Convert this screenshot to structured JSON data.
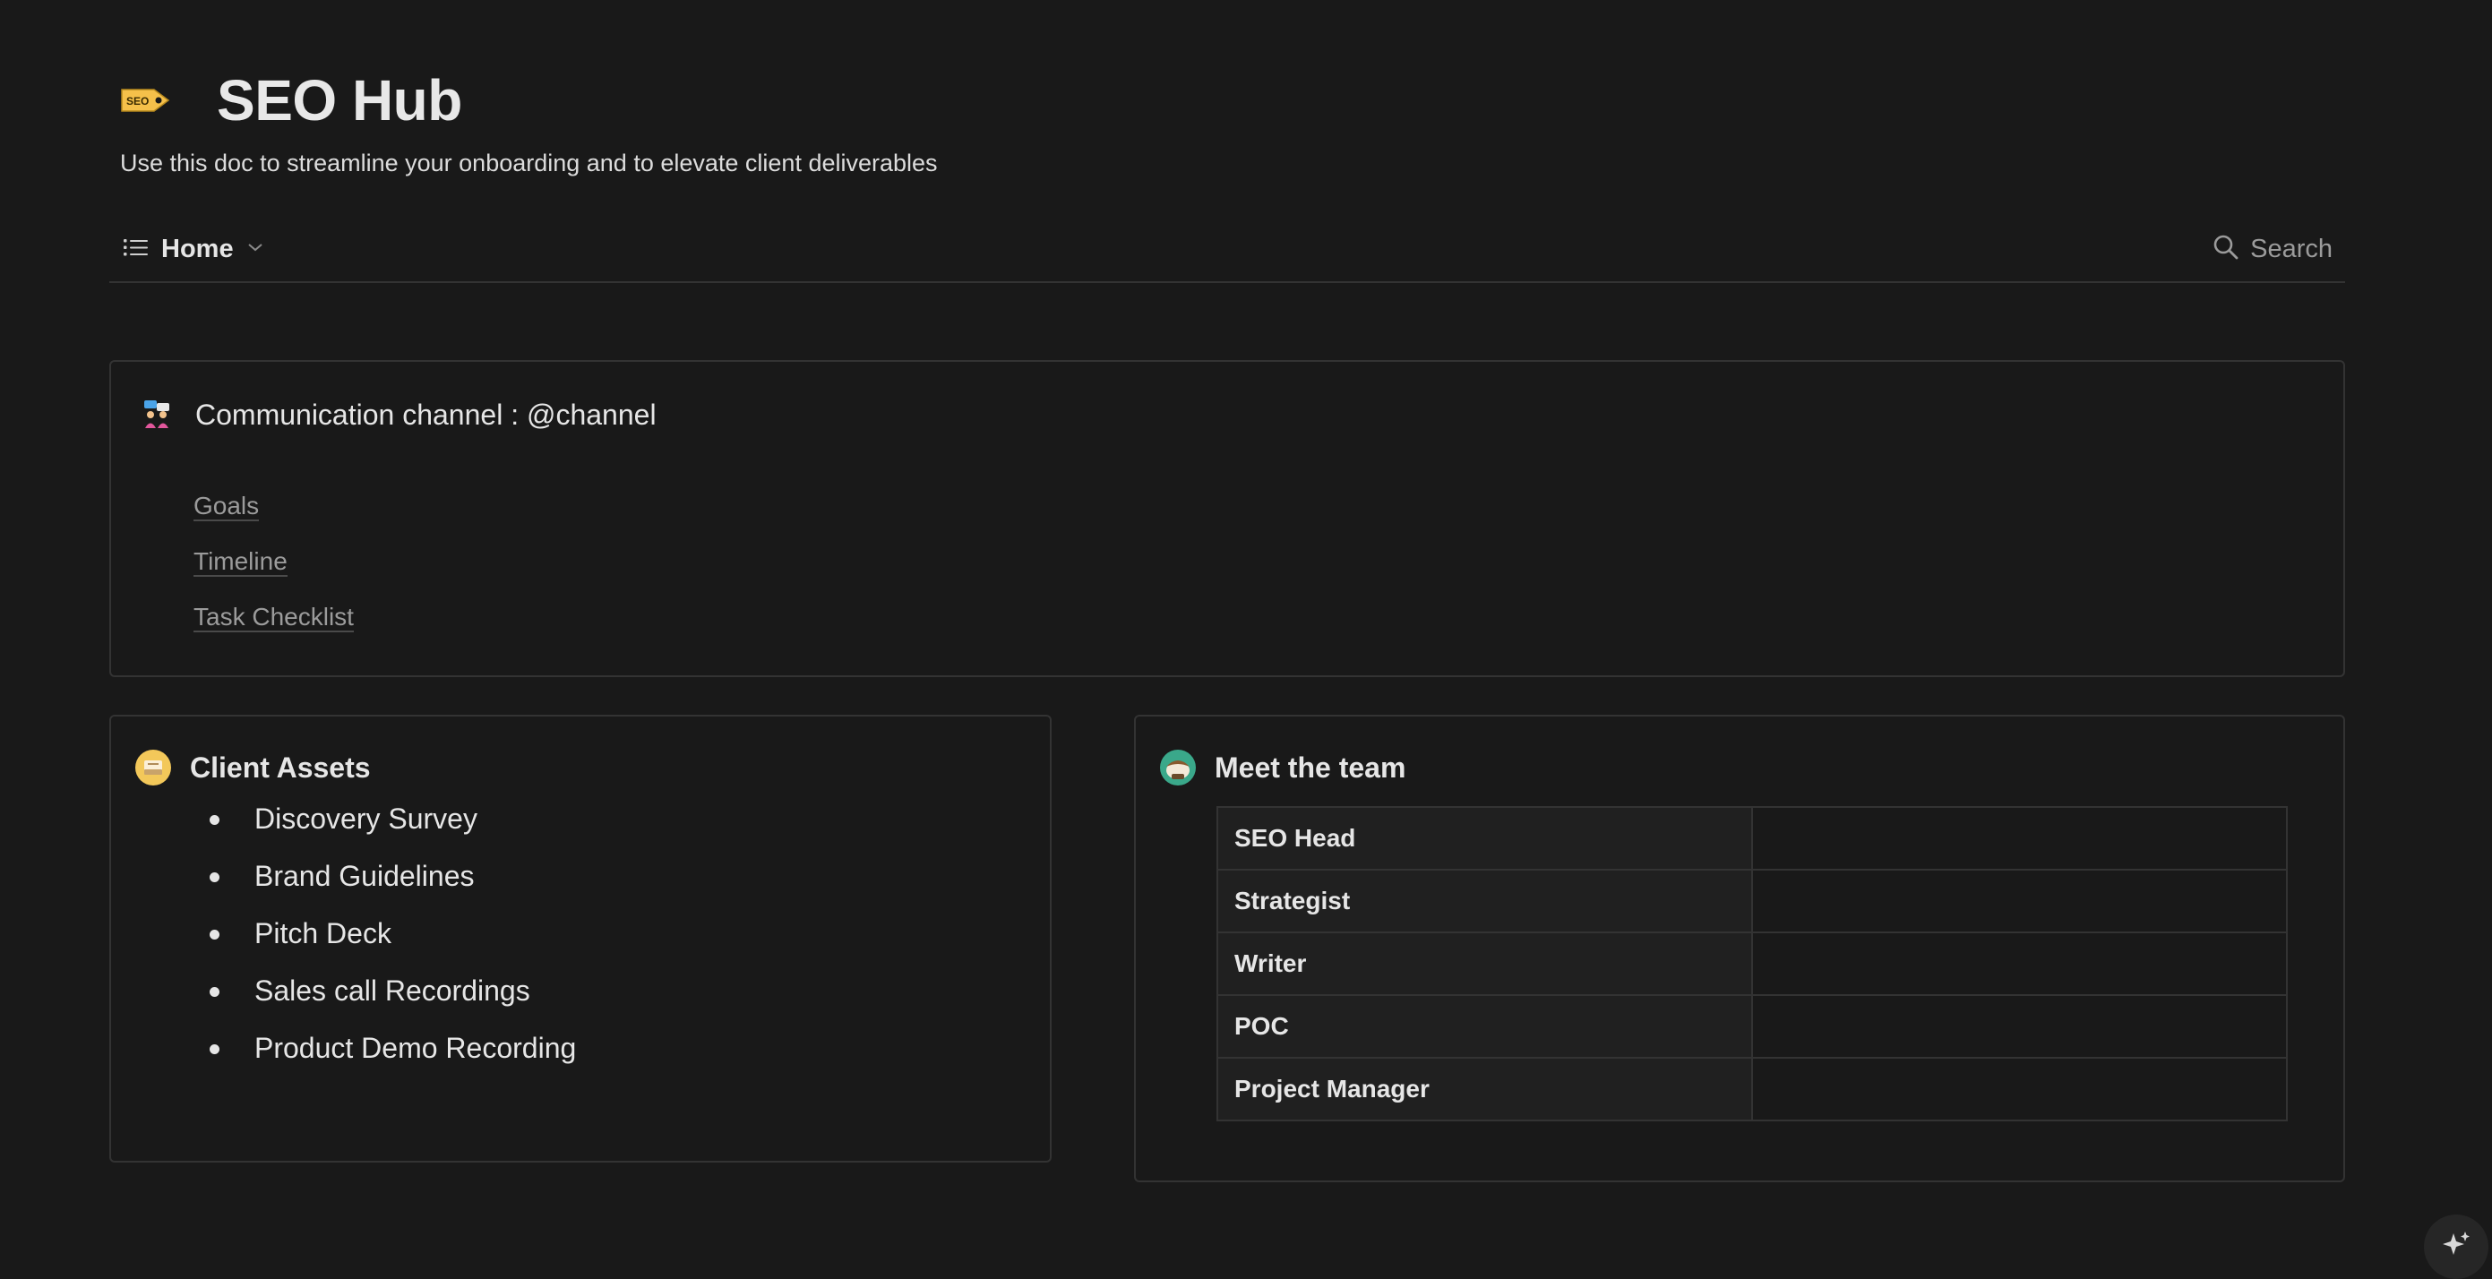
{
  "header": {
    "icon": "seo-tag-icon",
    "icon_text": "SEO",
    "title": "SEO Hub",
    "subtitle": "Use this doc to streamline your onboarding and to elevate client deliverables"
  },
  "navbar": {
    "home_label": "Home",
    "search_label": "Search"
  },
  "communication": {
    "icon": "people-chat-icon",
    "title": "Communication channel : @channel",
    "links": [
      "Goals",
      "Timeline",
      "Task Checklist"
    ]
  },
  "client_assets": {
    "icon": "inbox-tray-icon",
    "title": "Client Assets",
    "items": [
      "Discovery Survey",
      "Brand Guidelines",
      "Pitch Deck",
      "Sales call Recordings",
      "Product Demo Recording"
    ]
  },
  "team": {
    "icon": "team-avatar-icon",
    "title": "Meet the team",
    "roles": [
      "SEO Head",
      "Strategist",
      "Writer",
      "POC",
      "Project Manager"
    ],
    "names": [
      "",
      "",
      "",
      "",
      ""
    ]
  },
  "colors": {
    "background": "#191919",
    "border": "#333333",
    "text": "#e6e6e6",
    "muted": "#9b9b9b",
    "tag_yellow": "#f5c04a"
  }
}
